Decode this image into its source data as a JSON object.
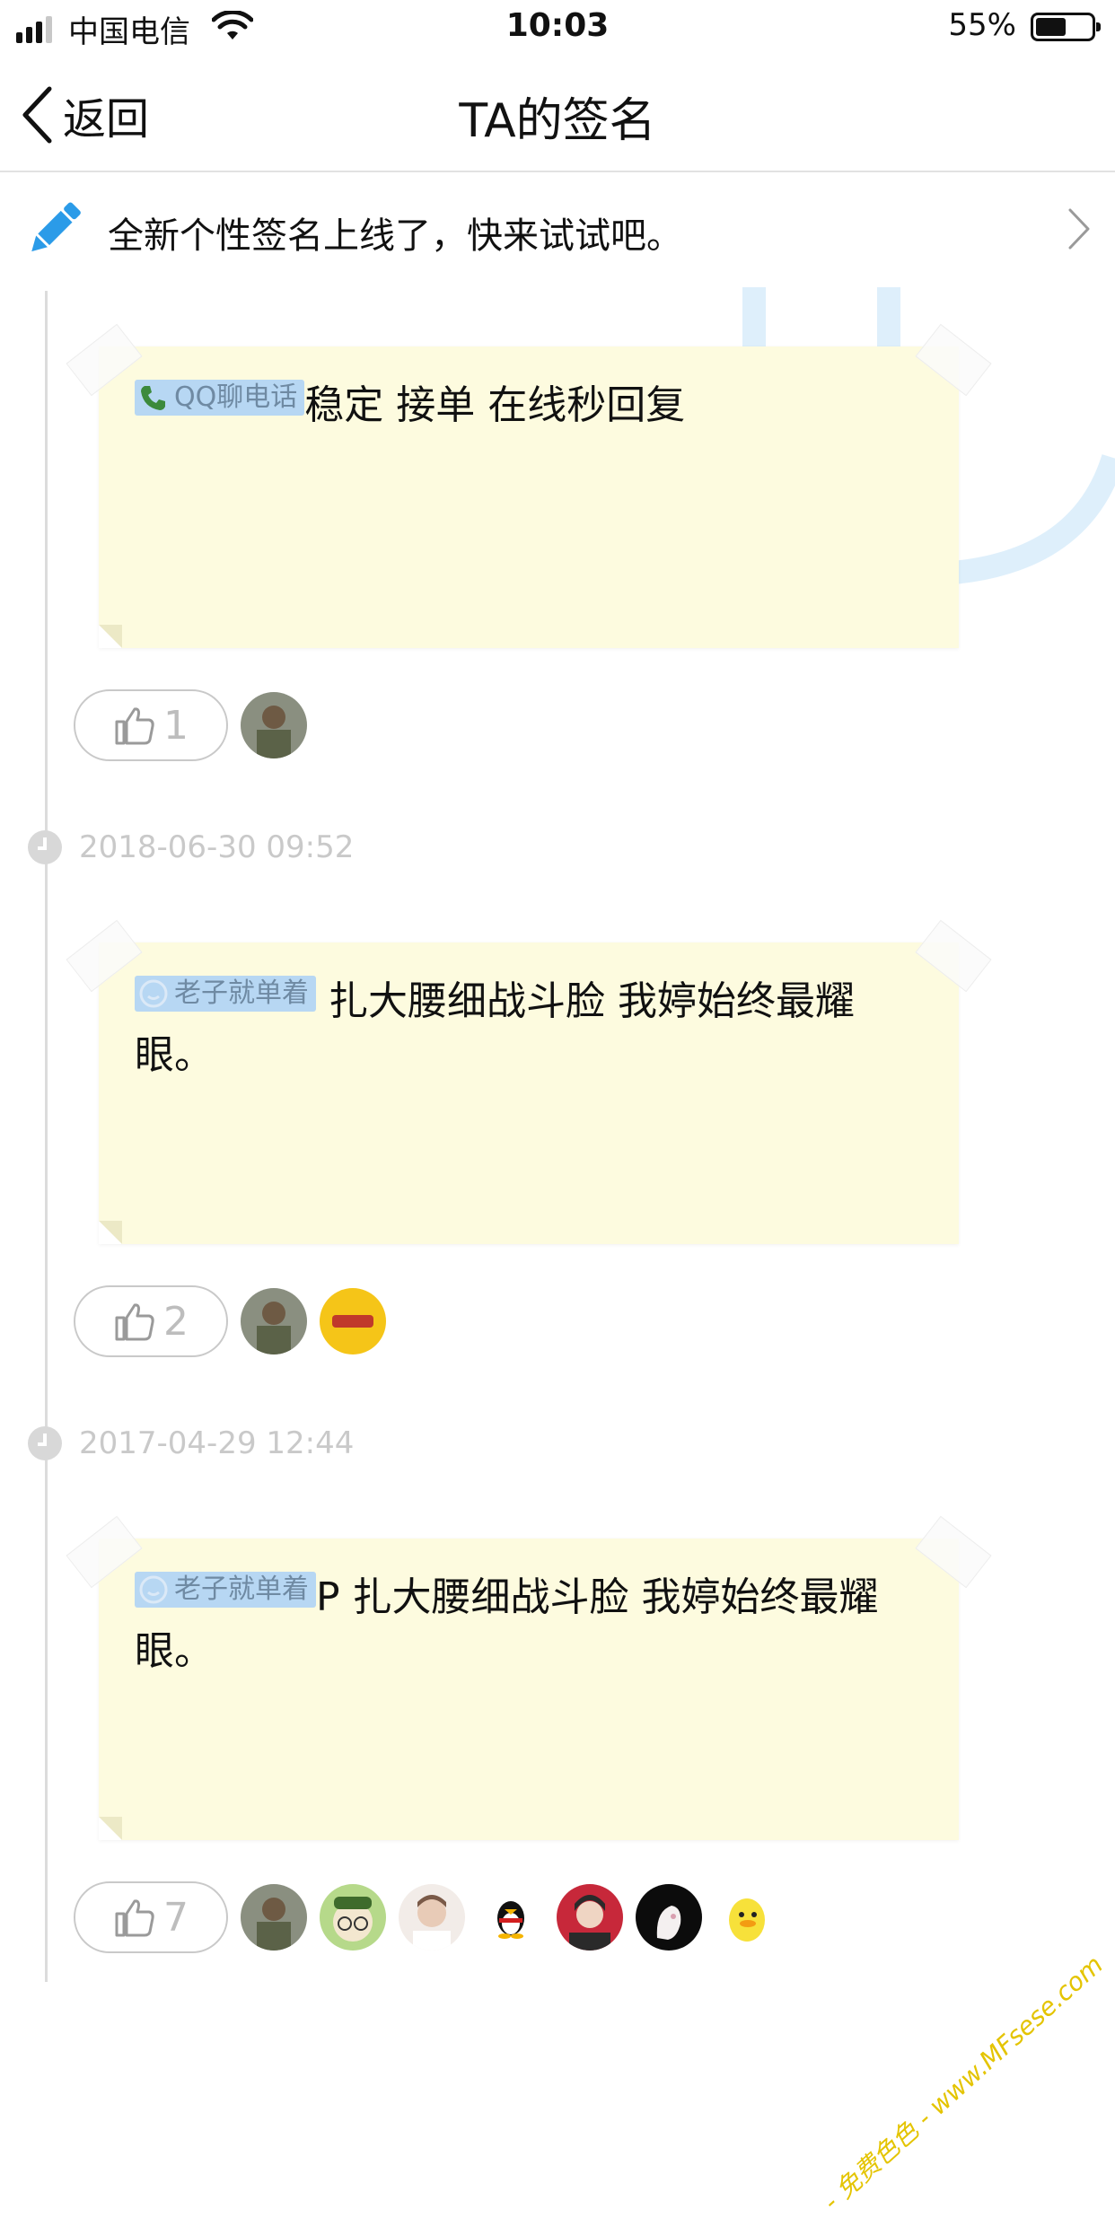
{
  "status_bar": {
    "carrier": "中国电信",
    "time": "10:03",
    "battery_percent_text": "55%",
    "battery_level": 0.55,
    "signal_bars_filled": 3,
    "signal_bars_total": 4
  },
  "nav": {
    "back_label": "返回",
    "title": "TA的签名"
  },
  "banner": {
    "text": "全新个性签名上线了，快来试试吧。",
    "icon": "pencil-icon",
    "accent": "#2b9be8"
  },
  "entries": [
    {
      "tag_label": "QQ聊电话",
      "tag_icon": "phone-icon",
      "text": "稳定 接单  在线秒回复",
      "like_count": "1"
    },
    {
      "timestamp": "2018-06-30 09:52",
      "tag_label": "老子就单着",
      "tag_icon": "mood-icon",
      "text": " 扎大腰细战斗脸 我婷始终最耀眼。",
      "like_count": "2"
    },
    {
      "timestamp": "2017-04-29 12:44",
      "tag_label": "老子就单着",
      "tag_icon": "mood-icon",
      "text": "P 扎大腰细战斗脸 我婷始终最耀眼。",
      "like_count": "7"
    }
  ],
  "watermark": "- 免费色色 - www.MFsese.com",
  "colors": {
    "note_background": "#fdfbdf",
    "tag_background": "#b7d7f3",
    "timestamp": "#c9c9c9"
  }
}
